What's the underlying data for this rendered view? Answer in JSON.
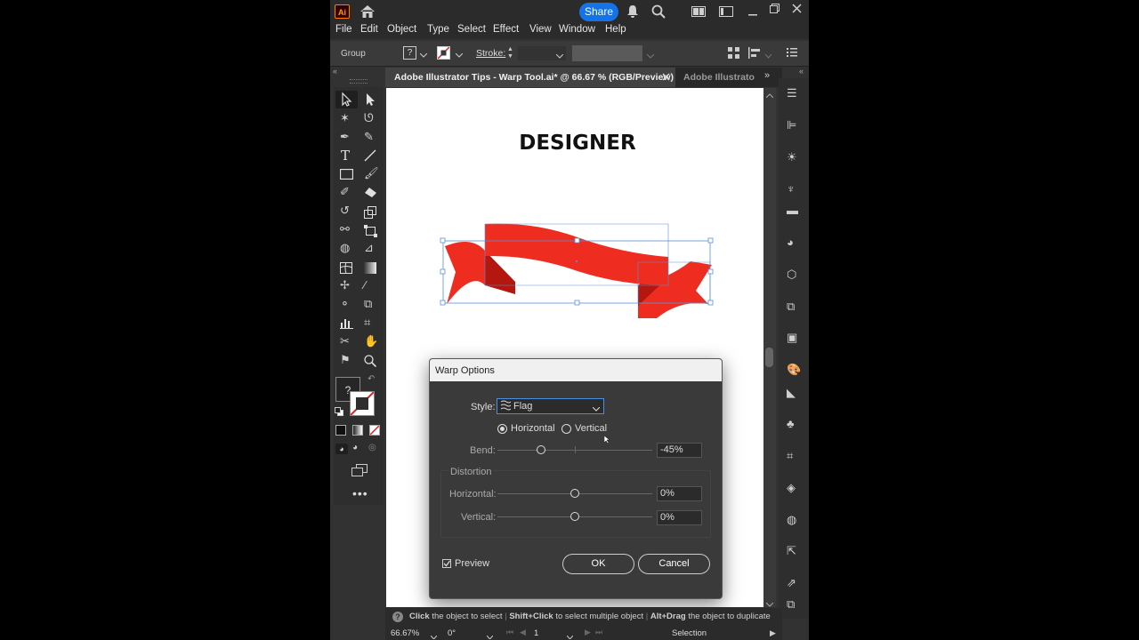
{
  "titlebar": {
    "logo": "Ai",
    "share_label": "Share"
  },
  "menu": [
    "File",
    "Edit",
    "Object",
    "Type",
    "Select",
    "Effect",
    "View",
    "Window",
    "Help"
  ],
  "control_bar": {
    "selection_type": "Group",
    "stroke_label": "Stroke:"
  },
  "tabs": {
    "active": "Adobe Illustrator Tips - Warp Tool.ai* @ 66.67 % (RGB/Preview)",
    "inactive": "Adobe Illustrato"
  },
  "artboard": {
    "heading": "DESIGNER",
    "ribbon_color": "#ee2d20"
  },
  "dialog": {
    "title": "Warp Options",
    "style_label": "Style:",
    "style_value": "Flag",
    "orientation_horizontal": "Horizontal",
    "orientation_vertical": "Vertical",
    "orientation_selected": "Horizontal",
    "bend_label": "Bend:",
    "bend_value": "-45%",
    "bend_level": -45,
    "distortion_label": "Distortion",
    "dist_horizontal_label": "Horizontal:",
    "dist_horizontal_value": "0%",
    "dist_vertical_label": "Vertical:",
    "dist_vertical_value": "0%",
    "preview_label": "Preview",
    "preview_checked": true,
    "ok_label": "OK",
    "cancel_label": "Cancel"
  },
  "status": {
    "click": "Click",
    "click_text": "the object to select",
    "shift_click": "Shift+Click",
    "shift_text": "to select multiple object",
    "alt_drag": "Alt+Drag",
    "alt_text": "the object to duplicate"
  },
  "bottom": {
    "zoom": "66.67%",
    "rotation": "0°",
    "page": "1",
    "tool": "Selection"
  },
  "colors": {
    "accent": "#1473e6",
    "app_bg": "#323232",
    "ribbon": "#ee2d20",
    "ribbon_dark": "#c21a12"
  }
}
